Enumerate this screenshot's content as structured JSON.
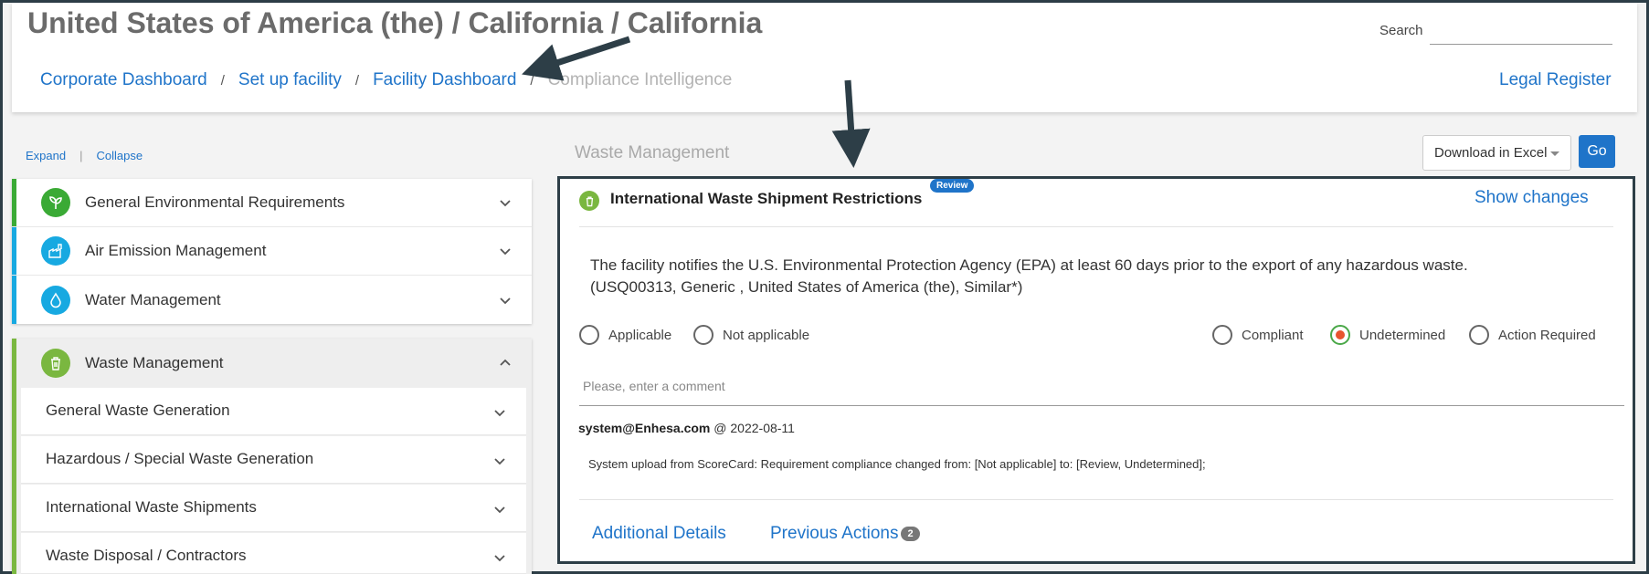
{
  "header": {
    "title": "United States of America (the) / California / California",
    "search_label": "Search",
    "search_value": ""
  },
  "breadcrumb": {
    "items": [
      "Corporate Dashboard",
      "Set up facility",
      "Facility Dashboard"
    ],
    "separator": "/",
    "current": "Compliance Intelligence"
  },
  "legal_register_label": "Legal Register",
  "tree_controls": {
    "expand": "Expand",
    "separator": "|",
    "collapse": "Collapse"
  },
  "categories": [
    {
      "label": "General Environmental Requirements",
      "icon": "plant-icon",
      "color": "#3aaa35"
    },
    {
      "label": "Air Emission Management",
      "icon": "factory-icon",
      "color": "#17a9e1"
    },
    {
      "label": "Water Management",
      "icon": "water-drop-icon",
      "color": "#17a9e1"
    }
  ],
  "waste_group": {
    "label": "Waste Management",
    "icon": "trash-icon",
    "color": "#7ab740",
    "subitems": [
      "General Waste Generation",
      "Hazardous / Special Waste Generation",
      "International Waste Shipments",
      "Waste Disposal / Contractors"
    ]
  },
  "main": {
    "section_title": "Waste Management",
    "download_option": "Download in Excel",
    "go_label": "Go"
  },
  "requirement": {
    "title": "International Waste Shipment Restrictions",
    "badge": "Review",
    "show_changes": "Show changes",
    "text_line1": "The facility notifies the U.S. Environmental Protection Agency (EPA) at least 60 days prior to the export of any hazardous waste.",
    "text_line2": "(USQ00313, Generic , United States of America (the), Similar*)",
    "applicability": [
      "Applicable",
      "Not applicable"
    ],
    "compliance": [
      "Compliant",
      "Undetermined",
      "Action Required"
    ],
    "selected_compliance": "Undetermined",
    "comment_placeholder": "Please, enter a comment",
    "log_author": "system@Enhesa.com",
    "log_date": "@ 2022-08-11",
    "log_text": "System upload from ScoreCard: Requirement compliance changed from: [Not applicable] to: [Review, Undetermined];",
    "tab_additional": "Additional Details",
    "tab_previous": "Previous Actions",
    "previous_count": "2"
  },
  "colors": {
    "link": "#1f74c9",
    "frame": "#2d3e47",
    "selected_radio": "#e8542e"
  }
}
